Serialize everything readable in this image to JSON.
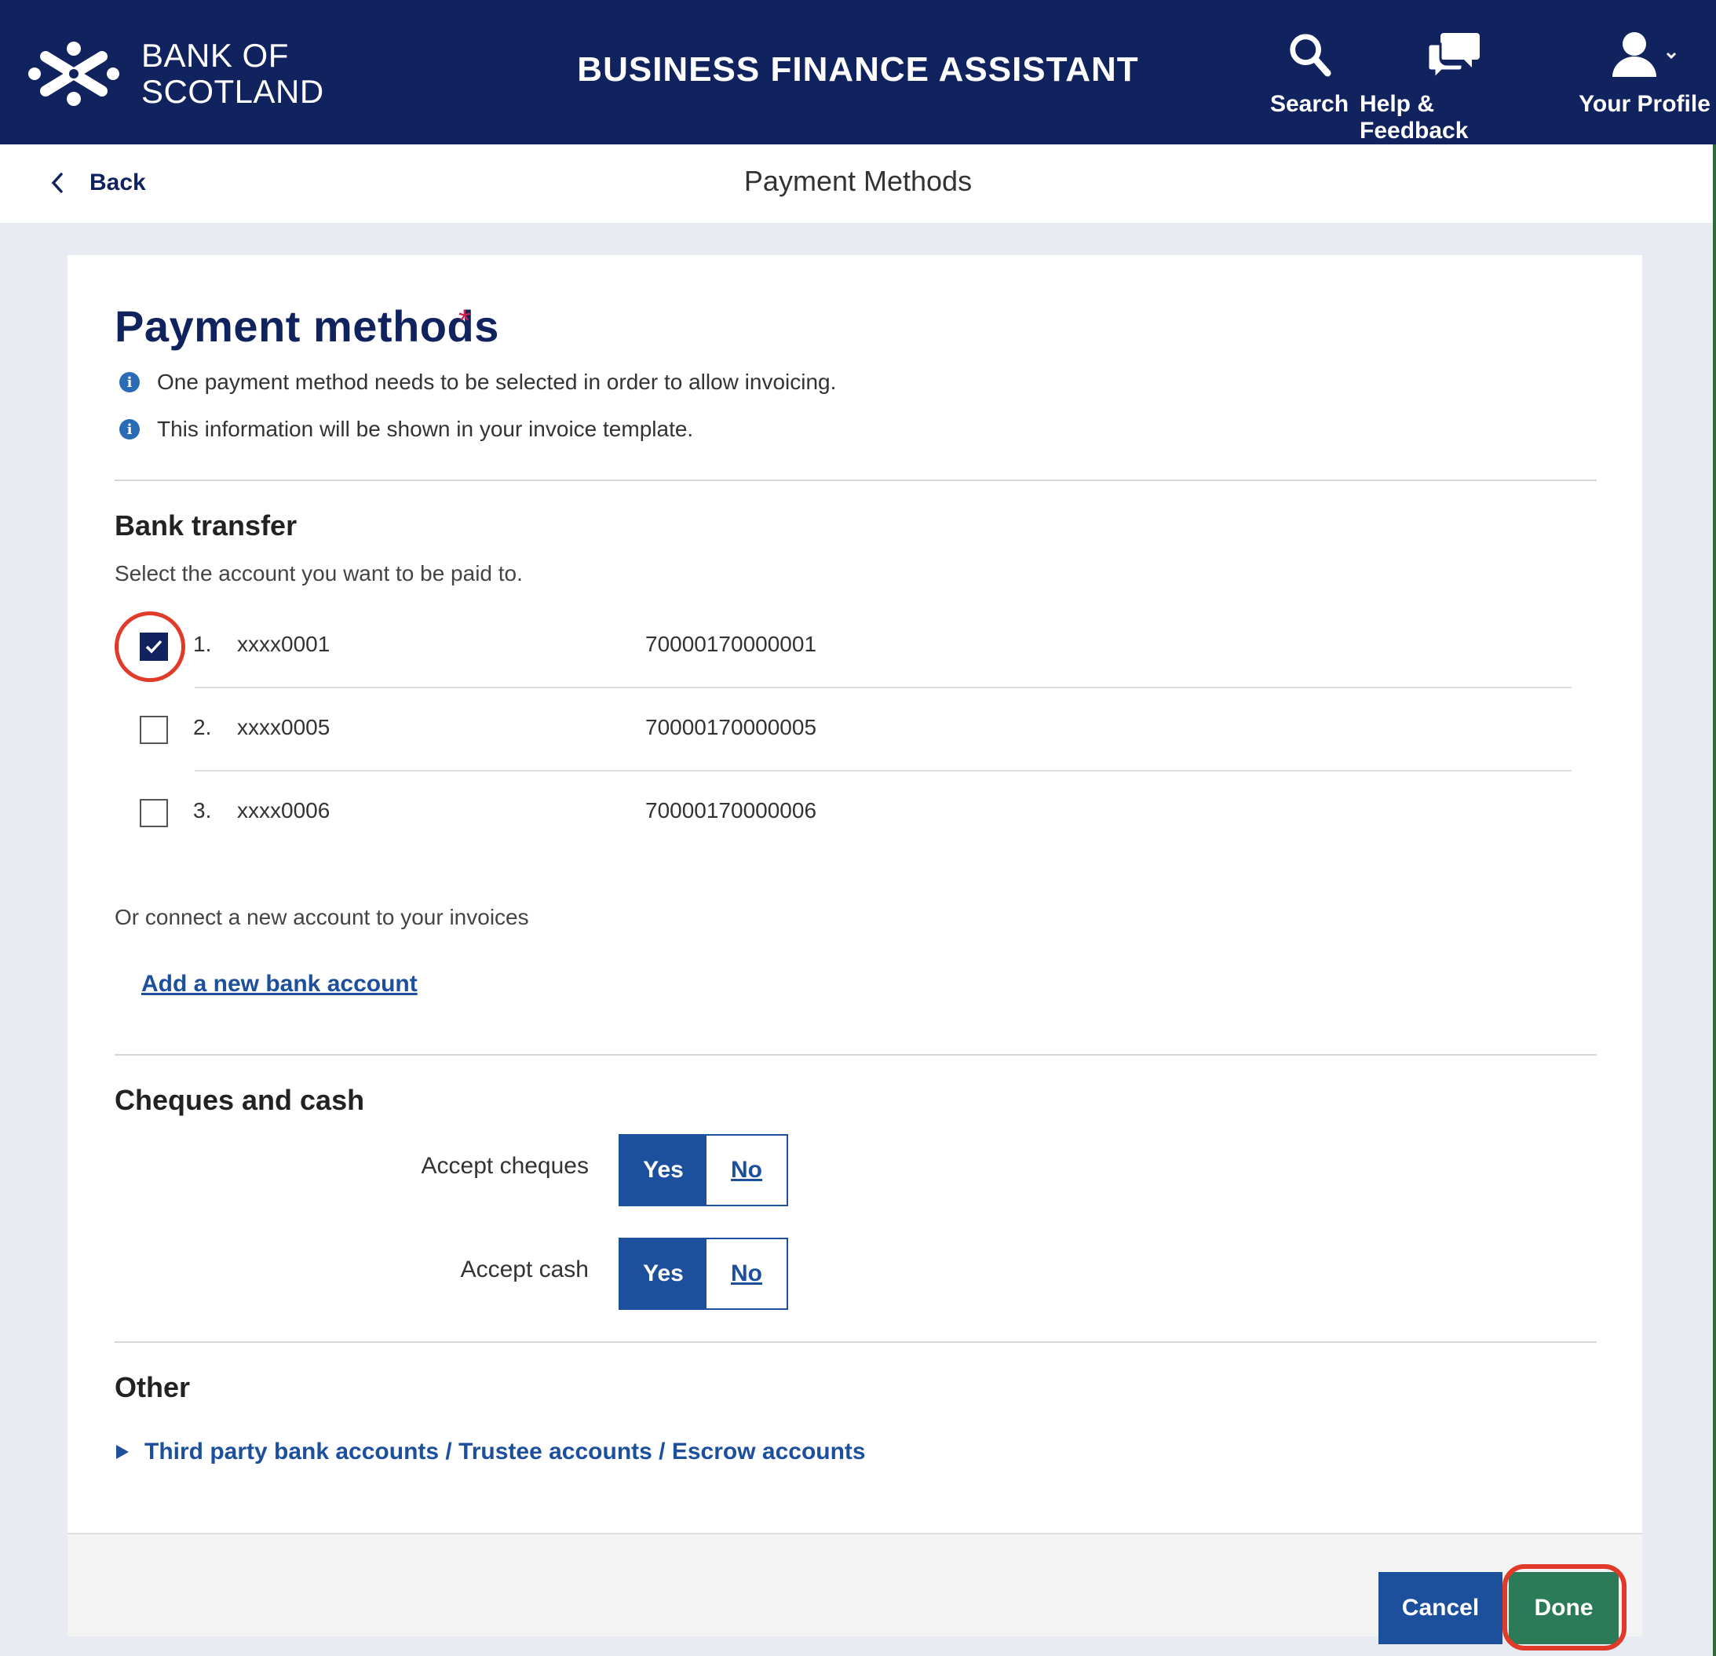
{
  "header": {
    "brand_line1": "BANK OF",
    "brand_line2": "SCOTLAND",
    "app_title": "BUSINESS FINANCE ASSISTANT",
    "nav": {
      "search": "Search",
      "help": "Help & Feedback",
      "profile": "Your Profile"
    }
  },
  "subbar": {
    "back_label": "Back",
    "title": "Payment Methods"
  },
  "content": {
    "heading": "Payment methods",
    "required_marker": "*",
    "info": [
      "One payment method needs to be selected in order to allow invoicing.",
      "This information will be shown in your invoice template."
    ],
    "bank_transfer": {
      "heading": "Bank transfer",
      "instruction": "Select the account you want to be paid to.",
      "accounts": [
        {
          "index": "1.",
          "masked": "xxxx0001",
          "full": "70000170000001",
          "checked": true
        },
        {
          "index": "2.",
          "masked": "xxxx0005",
          "full": "70000170000005",
          "checked": false
        },
        {
          "index": "3.",
          "masked": "xxxx0006",
          "full": "70000170000006",
          "checked": false
        }
      ],
      "connect_text": "Or connect a new account to your invoices",
      "add_link": "Add a new bank account"
    },
    "cheques_cash": {
      "heading": "Cheques and cash",
      "cheques_label": "Accept cheques",
      "cash_label": "Accept cash",
      "yes": "Yes",
      "no": "No",
      "cheques_value": "Yes",
      "cash_value": "Yes"
    },
    "other": {
      "heading": "Other",
      "expander": "Third party bank accounts / Trustee accounts / Escrow accounts"
    }
  },
  "footer": {
    "cancel": "Cancel",
    "done": "Done"
  },
  "colors": {
    "navy": "#11235f",
    "blue": "#1c4f9c",
    "green": "#2b7a58",
    "highlight": "#e03a2a",
    "required": "#d4204b"
  }
}
